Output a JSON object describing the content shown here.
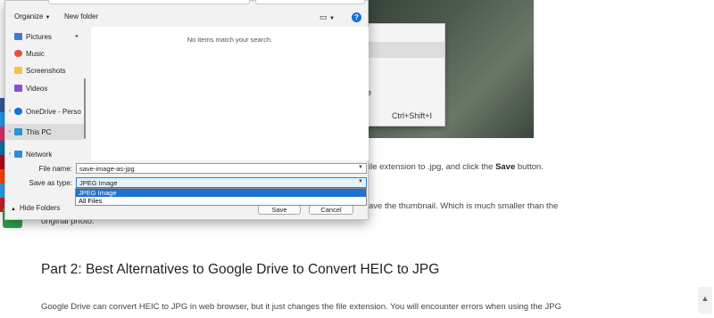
{
  "toolbar": {
    "organize_label": "Organize",
    "new_folder_label": "New folder"
  },
  "nav": {
    "items": [
      {
        "label": "Pictures",
        "icon": "pictures-folder-icon",
        "color": "#3a7bd5"
      },
      {
        "label": "Music",
        "icon": "music-icon",
        "color": "#e0533d"
      },
      {
        "label": "Screenshots",
        "icon": "folder-icon",
        "color": "#f2c14e"
      },
      {
        "label": "Videos",
        "icon": "videos-icon",
        "color": "#8a4fd6"
      },
      {
        "label": "OneDrive - Perso",
        "icon": "onedrive-icon",
        "color": "#1b6fd1"
      },
      {
        "label": "This PC",
        "icon": "pc-icon",
        "color": "#2d8fd8"
      },
      {
        "label": "Network",
        "icon": "network-icon",
        "color": "#2d8fd8"
      }
    ]
  },
  "filelist": {
    "empty_message": "No items match your search."
  },
  "form": {
    "file_name_label": "File name:",
    "file_name_value": "save-image-as-jpg",
    "save_as_type_label": "Save as type:",
    "save_as_type_value": "JPEG Image",
    "type_options": [
      "JPEG Image",
      "All Files"
    ]
  },
  "footer": {
    "hide_folders_label": "Hide Folders",
    "save_label": "Save",
    "cancel_label": "Cancel"
  },
  "background": {
    "context_menu": {
      "item_1": "b",
      "item_2": "age",
      "shortcut": "Ctrl+Shift+I"
    },
    "para1_pre": "ile extension to .jpg, and click the ",
    "para1_bold": "Save",
    "para1_post": " button.",
    "para2_line1": "ave the thumbnail. Which is much smaller than the",
    "para2_line2": "original photo.",
    "heading": "Part 2: Best Alternatives to Google Drive to Convert HEIC to JPG",
    "para3": "Google Drive can convert HEIC to JPG in web browser, but it just changes the file extension. You will encounter errors when using the JPG"
  },
  "colors": {
    "accent": "#1e72d0",
    "help_blue": "#1a6ed8",
    "chat_green": "#2fa34b"
  }
}
